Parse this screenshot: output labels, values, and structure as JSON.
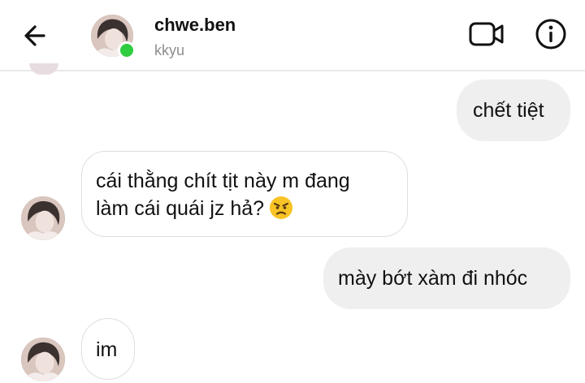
{
  "header": {
    "contact_name": "chwe.ben",
    "contact_username": "kkyu",
    "online": true,
    "icons": {
      "back": "back-arrow-icon",
      "video": "video-camera-icon",
      "info": "info-icon"
    }
  },
  "messages": [
    {
      "direction": "outgoing",
      "text": "chết tiệt"
    },
    {
      "direction": "incoming",
      "lines": [
        "cái thằng chít tịt này m đang",
        "làm cái quái jz hả?"
      ],
      "emoji": "angry-face-emoji"
    },
    {
      "direction": "outgoing",
      "text": "mày bớt xàm đi nhóc"
    },
    {
      "direction": "incoming",
      "text": "im"
    }
  ],
  "colors": {
    "online_dot": "#2ecc40",
    "outgoing_bubble": "#efefef",
    "incoming_border": "#dedede",
    "secondary_text": "#8e8e8e"
  }
}
